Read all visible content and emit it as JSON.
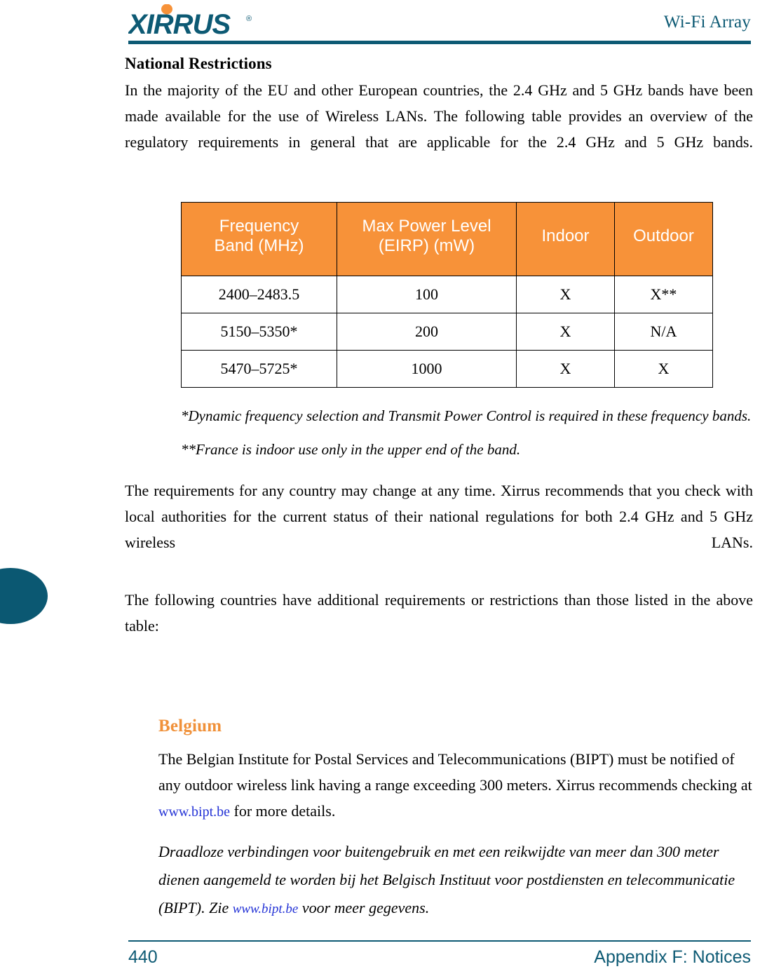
{
  "header": {
    "logo_text": "XIRRUS",
    "logo_trademark": "®",
    "title": "Wi-Fi Array",
    "brand_teal": "#0d5a74",
    "brand_orange": "#f79239"
  },
  "main": {
    "section_title": "National Restrictions",
    "intro_paragraph": "In the majority of the EU and other European countries, the 2.4 GHz and 5 GHz bands have been made available for the use of Wireless LANs. The following table provides an overview of the regulatory requirements in general that are applicable for the 2.4 GHz and 5 GHz bands.",
    "table": {
      "columns": [
        "Frequency Band (MHz)",
        "Max Power Level (EIRP) (mW)",
        "Indoor",
        "Outdoor"
      ],
      "column_lines": [
        [
          "Frequency",
          "Band (MHz)"
        ],
        [
          "Max Power Level",
          "(EIRP) (mW)"
        ],
        [
          "Indoor"
        ],
        [
          "Outdoor"
        ]
      ],
      "rows": [
        [
          "2400–2483.5",
          "100",
          "X",
          "X**"
        ],
        [
          "5150–5350*",
          "200",
          "X",
          "N/A"
        ],
        [
          "5470–5725*",
          "1000",
          "X",
          "X"
        ]
      ]
    },
    "footnote_1": "*Dynamic frequency selection and Transmit Power Control is required in these frequency bands.",
    "footnote_2": "**France is indoor use only in the upper end of the band.",
    "paragraph_2": "The requirements for any country may change at any time. Xirrus recommends that you check with local authorities for the current status of their national regulations for both 2.4 GHz and 5 GHz wireless LANs.",
    "paragraph_3": "The following countries have additional requirements or restrictions than those listed in the above table:"
  },
  "country": {
    "title": "Belgium",
    "paragraph_en_before_link": "The Belgian Institute for Postal Services and Telecommunications (BIPT) must be notified of any outdoor wireless link having a range exceeding 300 meters. Xirrus recommends checking at ",
    "link_text": "www.bipt.be",
    "paragraph_en_after_link": " for more details.",
    "paragraph_nl_before_link": "Draadloze verbindingen voor buitengebruik en met een reikwijdte van meer dan 300 meter dienen aangemeld te worden bij het Belgisch Instituut voor postdiensten en telecommunicatie (BIPT). Zie ",
    "link_text_nl": "www.bipt.be",
    "paragraph_nl_after_link": " voor meer gegevens."
  },
  "footer": {
    "page_number": "440",
    "appendix_label": "Appendix F: Notices"
  }
}
